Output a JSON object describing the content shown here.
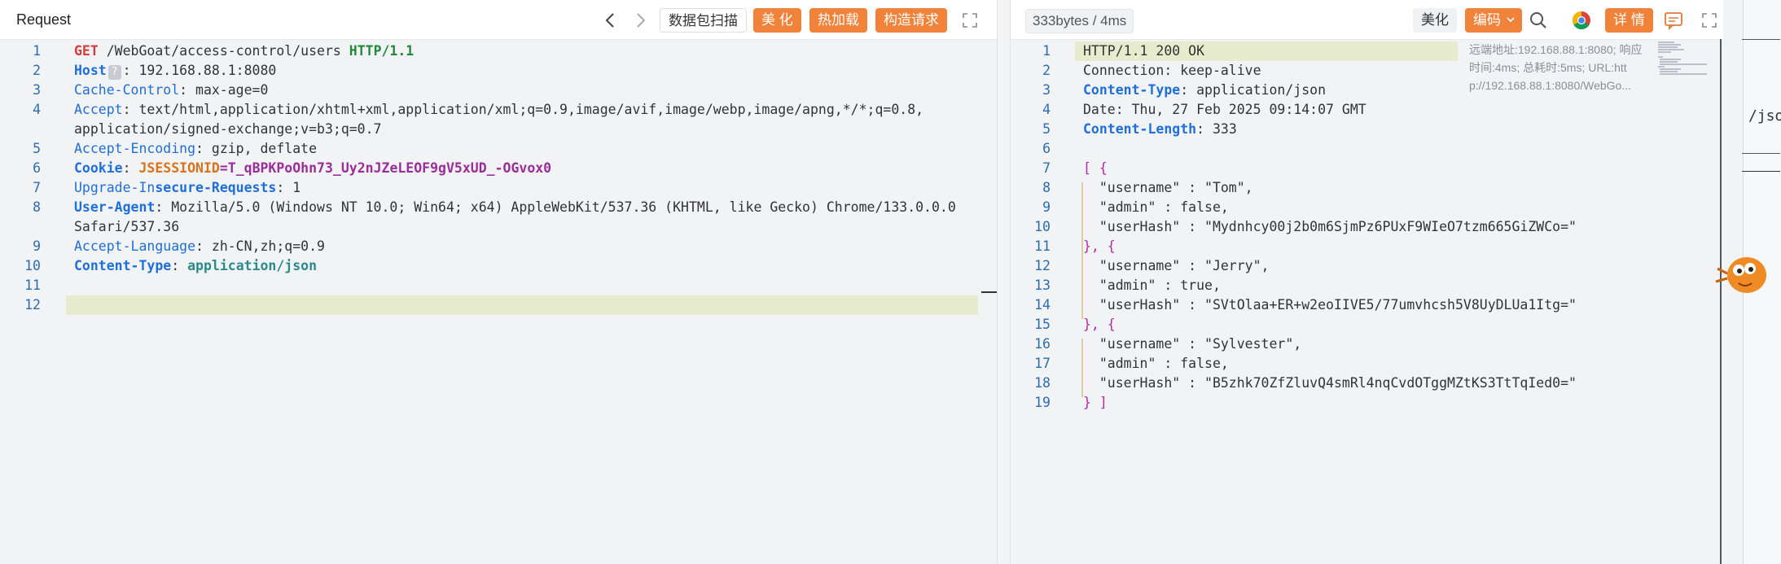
{
  "request": {
    "title": "Request",
    "toolbar": {
      "scan_label": "数据包扫描",
      "beautify_label": "美 化",
      "hotload_label": "热加载",
      "construct_label": "构造请求"
    },
    "lines": [
      {
        "n": "1",
        "segs": [
          [
            "GET",
            "k-red"
          ],
          [
            " /WebGoat/access-control/users ",
            "tx"
          ],
          [
            "HTTP/1.1",
            "k-green"
          ]
        ]
      },
      {
        "n": "2",
        "segs": [
          [
            "Host",
            "k-blueb"
          ],
          [
            "?",
            "badge"
          ],
          [
            ": 192.168.88.1:8080",
            "tx"
          ]
        ]
      },
      {
        "n": "3",
        "segs": [
          [
            "Cache-Control",
            "k-blue"
          ],
          [
            ": max-age=0",
            "tx"
          ]
        ]
      },
      {
        "n": "4",
        "segs": [
          [
            "Accept",
            "k-blue"
          ],
          [
            ": text/html,application/xhtml+xml,application/xml;q=0.9,image/avif,image/webp,image/apng,*/*;q=0.8,",
            "tx"
          ]
        ]
      },
      {
        "n": "",
        "segs": [
          [
            "application/signed-exchange;v=b3;q=0.7",
            "tx"
          ]
        ]
      },
      {
        "n": "5",
        "segs": [
          [
            "Accept-Encoding",
            "k-blue"
          ],
          [
            ": gzip, deflate",
            "tx"
          ]
        ]
      },
      {
        "n": "6",
        "segs": [
          [
            "Cookie",
            "k-blueb"
          ],
          [
            ": ",
            "tx"
          ],
          [
            "JSESSIONID",
            "k-orange"
          ],
          [
            "=T_qBPKPoOhn73_Uy2nJZeLEOF9gV5xUD_-OGvox0",
            "k-purple"
          ]
        ]
      },
      {
        "n": "7",
        "segs": [
          [
            "Upgrade-In",
            "k-blue"
          ],
          [
            "secure-Requests",
            "k-blueb"
          ],
          [
            ": 1",
            "tx"
          ]
        ]
      },
      {
        "n": "8",
        "segs": [
          [
            "User-Agent",
            "k-blueb"
          ],
          [
            ": Mozilla/5.0 (Windows NT 10.0; Win64; x64) AppleWebKit/537.36 (KHTML, like Gecko) Chrome/133.0.0.0 ",
            "tx"
          ]
        ]
      },
      {
        "n": "",
        "segs": [
          [
            "Safari/537.36",
            "tx"
          ]
        ]
      },
      {
        "n": "9",
        "segs": [
          [
            "Accept-Language",
            "k-blue"
          ],
          [
            ": zh-CN,zh;q=0.9",
            "tx"
          ]
        ]
      },
      {
        "n": "10",
        "segs": [
          [
            "Content-Type",
            "k-blueb"
          ],
          [
            ": ",
            "tx"
          ],
          [
            "application/json",
            "k-teal"
          ]
        ]
      },
      {
        "n": "11",
        "segs": []
      },
      {
        "n": "12",
        "segs": []
      }
    ]
  },
  "response": {
    "size_badge": "333bytes / 4ms",
    "toolbar": {
      "beautify_label": "美化",
      "encoding_label": "编码",
      "details_label": "详 情"
    },
    "meta_lines": [
      "远端地址:192.168.88.1:8080; 响应",
      "时间:4ms; 总耗时:5ms; URL:htt",
      "p://192.168.88.1:8080/WebGo..."
    ],
    "lines": [
      {
        "n": "1",
        "segs": [
          [
            "HTTP/1.1 200 OK",
            "tx"
          ]
        ]
      },
      {
        "n": "2",
        "segs": [
          [
            "Connection: keep-alive",
            "tx"
          ]
        ]
      },
      {
        "n": "3",
        "segs": [
          [
            "Content-Type",
            "k-blueb"
          ],
          [
            ": application/json",
            "tx"
          ]
        ]
      },
      {
        "n": "4",
        "segs": [
          [
            "Date: Thu, 27 Feb 2025 09:14:07 GMT",
            "tx"
          ]
        ]
      },
      {
        "n": "5",
        "segs": [
          [
            "Content-Length",
            "k-blueb"
          ],
          [
            ": 333",
            "tx"
          ]
        ]
      },
      {
        "n": "6",
        "segs": []
      },
      {
        "n": "7",
        "segs": [
          [
            "[ {",
            "k-pp"
          ]
        ]
      },
      {
        "n": "8",
        "segs": [
          [
            "  \"username\" : \"Tom\",",
            "tx"
          ]
        ]
      },
      {
        "n": "9",
        "segs": [
          [
            "  \"admin\" : false,",
            "tx"
          ]
        ]
      },
      {
        "n": "10",
        "segs": [
          [
            "  \"userHash\" : \"Mydnhcy00j2b0m6SjmPz6PUxF9WIeO7tzm665GiZWCo=\"",
            "tx"
          ]
        ]
      },
      {
        "n": "11",
        "segs": [
          [
            "}, {",
            "k-pp"
          ]
        ]
      },
      {
        "n": "12",
        "segs": [
          [
            "  \"username\" : \"Jerry\",",
            "tx"
          ]
        ]
      },
      {
        "n": "13",
        "segs": [
          [
            "  \"admin\" : true,",
            "tx"
          ]
        ]
      },
      {
        "n": "14",
        "segs": [
          [
            "  \"userHash\" : \"SVtOlaa+ER+w2eoIIVE5/77umvhcsh5V8UyDLUa1Itg=\"",
            "tx"
          ]
        ]
      },
      {
        "n": "15",
        "segs": [
          [
            "}, {",
            "k-pp"
          ]
        ]
      },
      {
        "n": "16",
        "segs": [
          [
            "  \"username\" : \"Sylvester\",",
            "tx"
          ]
        ]
      },
      {
        "n": "17",
        "segs": [
          [
            "  \"admin\" : false,",
            "tx"
          ]
        ]
      },
      {
        "n": "18",
        "segs": [
          [
            "  \"userHash\" : \"B5zhk70ZfZluvQ4smRl4nqCvdOTggMZtKS3TtTqIed0=\"",
            "tx"
          ]
        ]
      },
      {
        "n": "19",
        "segs": [
          [
            "} ]",
            "k-pp"
          ]
        ]
      }
    ]
  },
  "side_strip_text": "/jso"
}
